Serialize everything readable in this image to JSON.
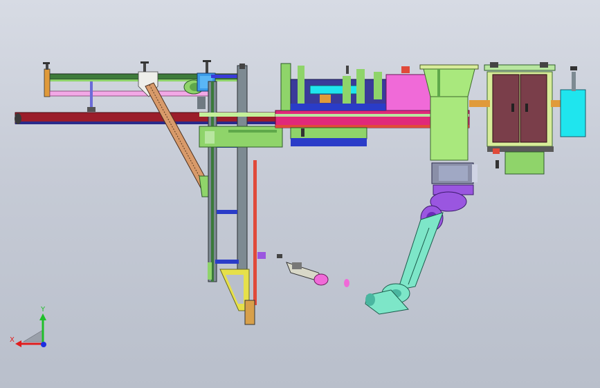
{
  "viewport": {
    "background_top": "#d7dbe4",
    "background_bottom": "#b9bfcb"
  },
  "triad": {
    "x_label": "X",
    "y_label": "Y",
    "x_color": "#e11d1d",
    "y_color": "#1fbf2a",
    "z_color": "#1d2fe0"
  },
  "colors": {
    "frame_green": "#8fd46a",
    "rail_red": "#9b1d2a",
    "rail_magenta": "#e0297a",
    "pink": "#f06ad8",
    "cyan": "#1fe5ee",
    "cabinet_brown": "#7a3e4a",
    "robot_cyan": "#7de6c8",
    "robot_purple": "#9a56e0",
    "steel_gray": "#6f7a82",
    "orange": "#e09a3a",
    "blue": "#2a3cc8",
    "light_green": "#a9e87d"
  }
}
